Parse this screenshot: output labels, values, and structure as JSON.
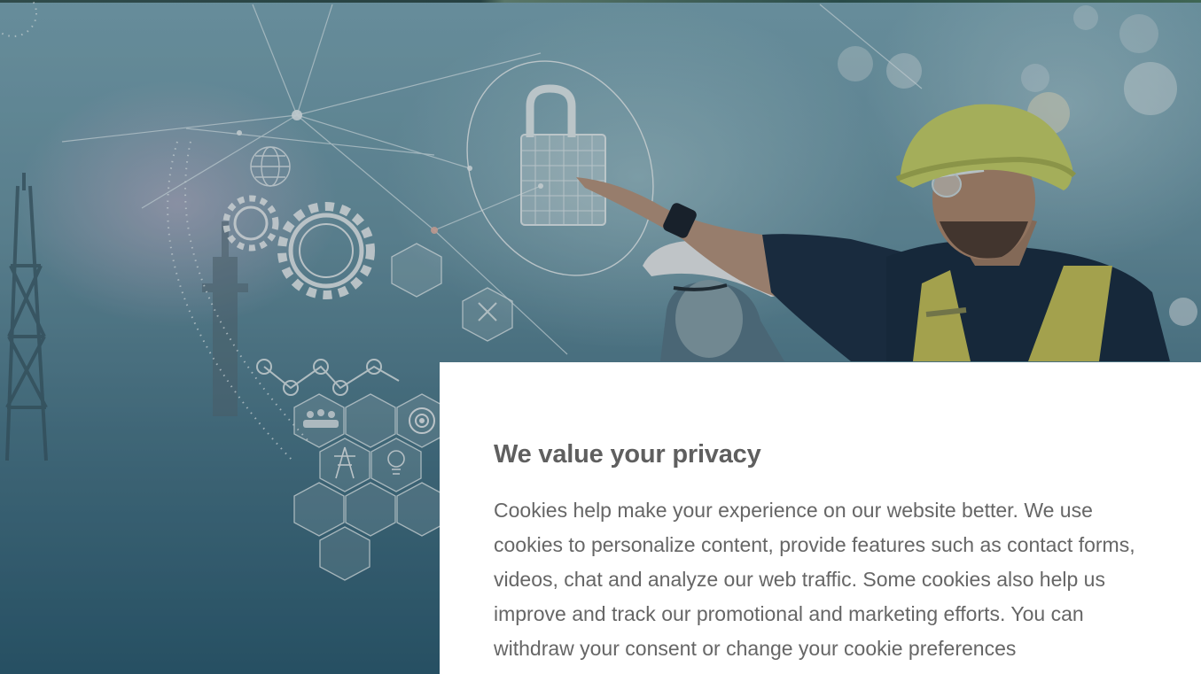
{
  "hero": {
    "icons": [
      "padlock-icon",
      "gear-icon",
      "globe-icon",
      "network-node-icon",
      "hexagon-icon",
      "power-tower-icon",
      "lightbulb-icon",
      "target-icon",
      "people-icon",
      "wrench-icon"
    ],
    "colors": {
      "sky_top": "#7eaab8",
      "sky_bottom": "#2f5f74",
      "hardhat": "#c9d26a",
      "vest": "#c7c25a",
      "shirt": "#1f3347"
    }
  },
  "consent": {
    "title": "We value your privacy",
    "body": "Cookies help make your experience on our website better. We use cookies to personalize content, provide features such as contact forms, videos, chat and analyze our web traffic. Some cookies also help us improve and track our promotional and marketing efforts. You can withdraw your consent or change your cookie preferences"
  }
}
